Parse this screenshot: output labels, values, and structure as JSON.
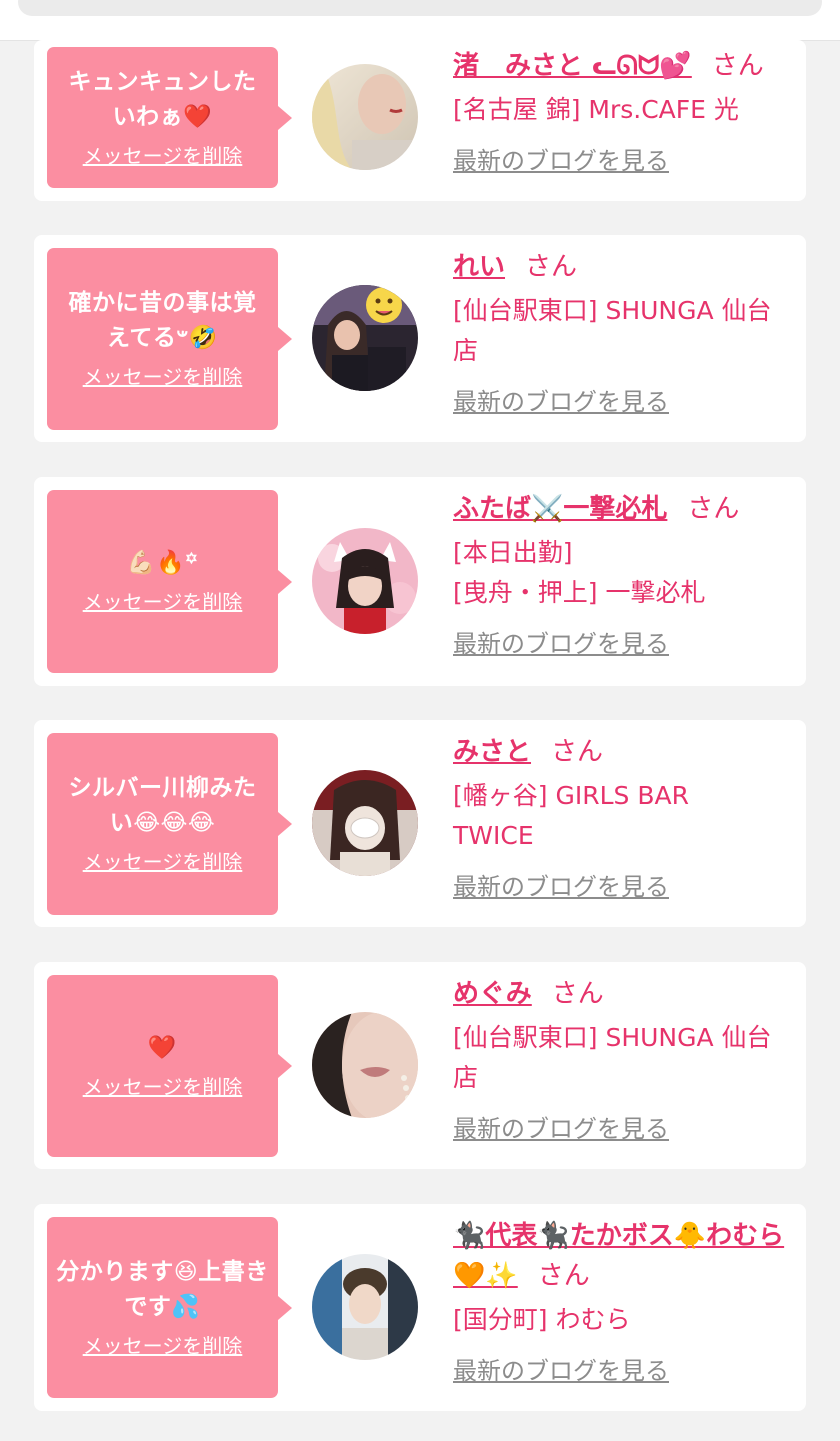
{
  "colors": {
    "accent": "#e6336b",
    "bubble": "#fb8ea1",
    "muted": "#8c8c8c"
  },
  "cards": [
    {
      "message": "キュンキュンしたいわぁ❤️",
      "delete_label": "メッセージを削除",
      "name": "渚　みさと ᓚᘏᗢ💕",
      "honorific": "さん",
      "shop_lines": [
        "[名古屋 錦] Mrs.CAFE 光"
      ],
      "blog_label": "最新のブログを見る"
    },
    {
      "message": "確かに昔の事は覚えてる𐤔🤣",
      "delete_label": "メッセージを削除",
      "name": "れい",
      "honorific": "さん",
      "shop_lines": [
        "[仙台駅東口] SHUNGA 仙台店"
      ],
      "blog_label": "最新のブログを見る"
    },
    {
      "message": "💪🏻🔥꙳",
      "delete_label": "メッセージを削除",
      "name": "ふたば⚔️一撃必札",
      "honorific": "さん",
      "shop_lines": [
        "[本日出勤]",
        "[曳舟・押上] 一撃必札"
      ],
      "blog_label": "最新のブログを見る"
    },
    {
      "message": "シルバー川柳みたい😂😂😂",
      "delete_label": "メッセージを削除",
      "name": "みさと",
      "honorific": "さん",
      "shop_lines": [
        "[幡ヶ谷] GIRLS BAR TWICE"
      ],
      "blog_label": "最新のブログを見る"
    },
    {
      "message": "❤️",
      "delete_label": "メッセージを削除",
      "name": "めぐみ",
      "honorific": "さん",
      "shop_lines": [
        "[仙台駅東口] SHUNGA 仙台店"
      ],
      "blog_label": "最新のブログを見る"
    },
    {
      "message": "分かります😆上書きです💦",
      "delete_label": "メッセージを削除",
      "name": "🐈‍⬛代表🐈‍⬛たかボス🐥わむら🧡✨",
      "honorific": "さん",
      "shop_lines": [
        "[国分町] わむら"
      ],
      "blog_label": "最新のブログを見る"
    }
  ]
}
